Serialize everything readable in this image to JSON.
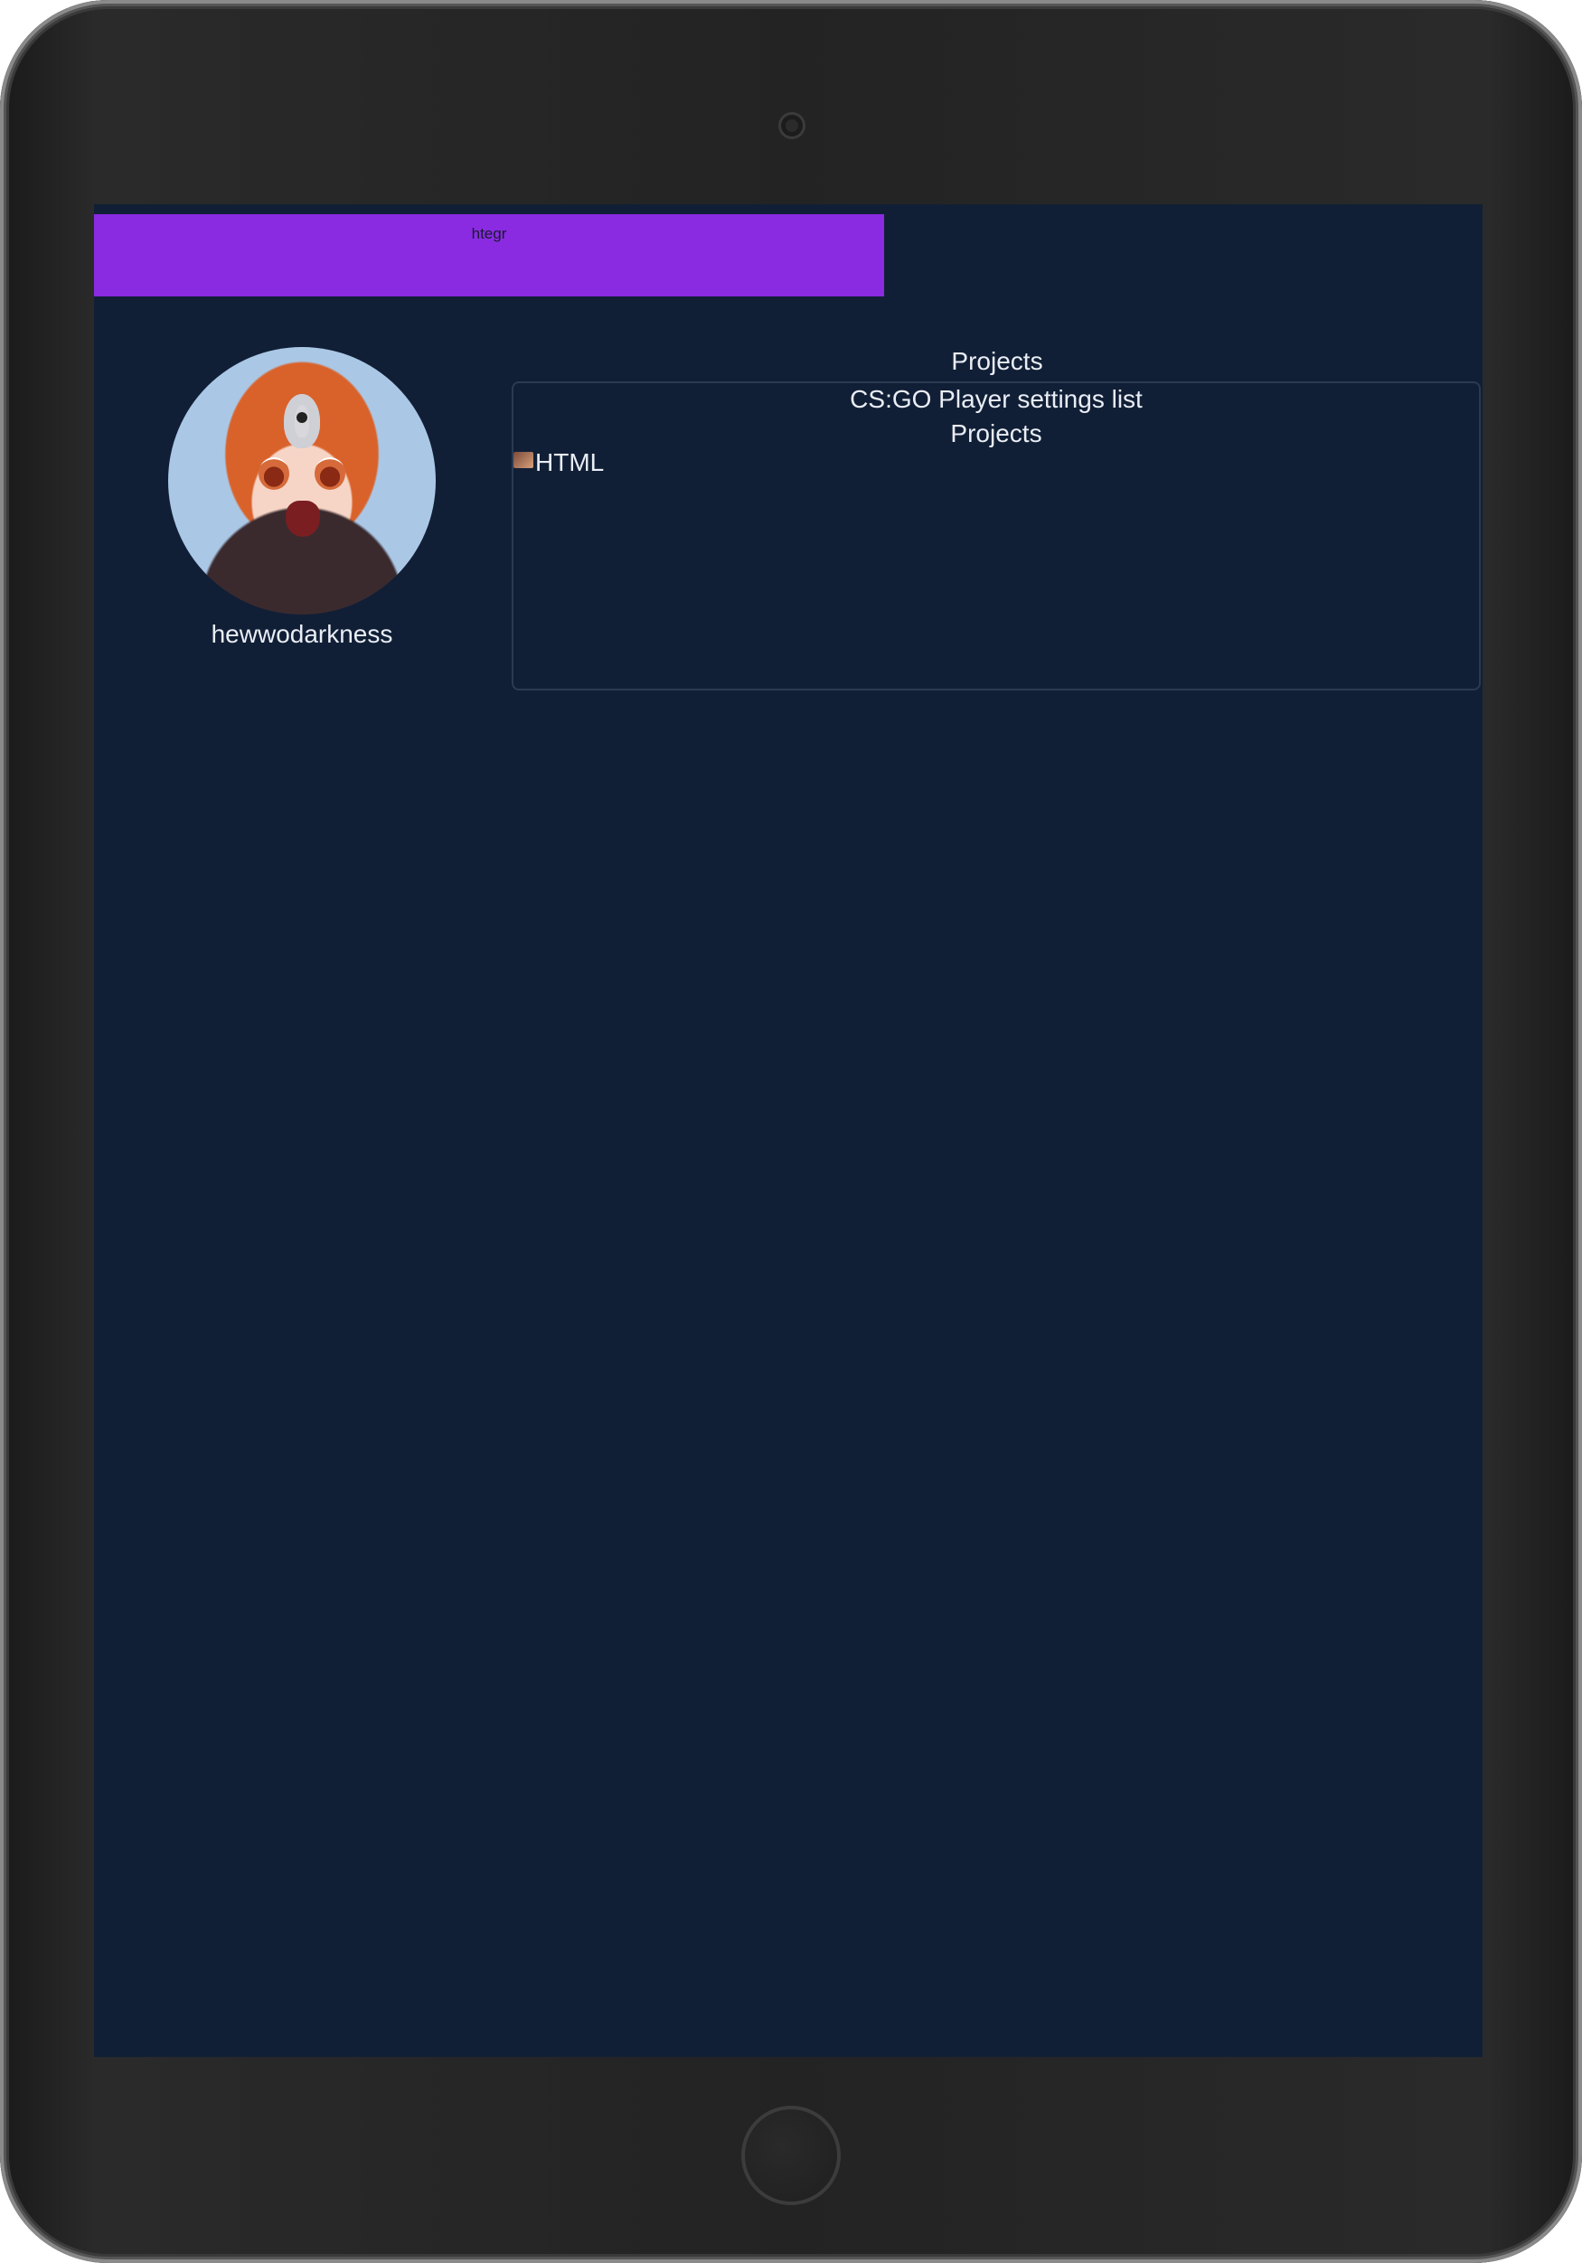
{
  "banner": {
    "text": "htegr",
    "color": "#8a2be2"
  },
  "profile": {
    "username": "hewwodarkness"
  },
  "projects": {
    "heading": "Projects",
    "items": [
      {
        "title": "CS:GO Player settings list",
        "subtitle": "Projects",
        "language": "HTML"
      }
    ]
  },
  "colors": {
    "screen_bg": "#111f36",
    "text": "#e9edf5",
    "card_border": "#2b3a52"
  }
}
